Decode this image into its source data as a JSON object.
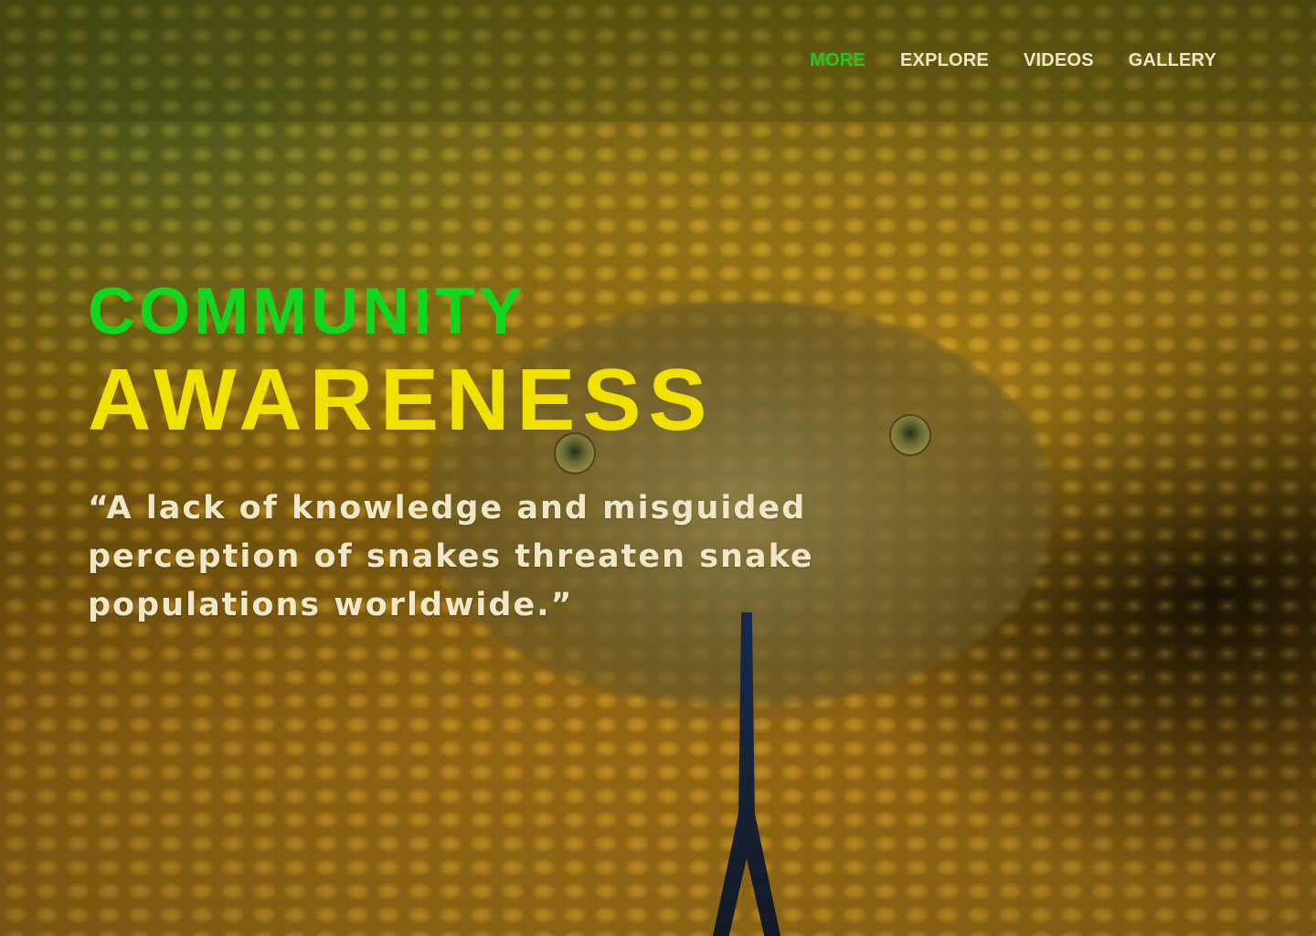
{
  "nav": {
    "items": [
      {
        "label": "MORE",
        "active": true
      },
      {
        "label": "EXPLORE",
        "active": false
      },
      {
        "label": "VIDEOS",
        "active": false
      },
      {
        "label": "GALLERY",
        "active": false
      }
    ]
  },
  "hero": {
    "kicker": "COMMUNITY",
    "title": "AWARENESS",
    "quote": "“A lack of knowledge and misguided perception of snakes threaten snake populations worldwide.”"
  },
  "colors": {
    "nav_active": "#1fc91f",
    "nav_default": "#efe8c8",
    "kicker": "#12d51d",
    "title": "#f0e100",
    "quote": "#efe8c8"
  },
  "background": {
    "subject": "rattlesnake"
  }
}
